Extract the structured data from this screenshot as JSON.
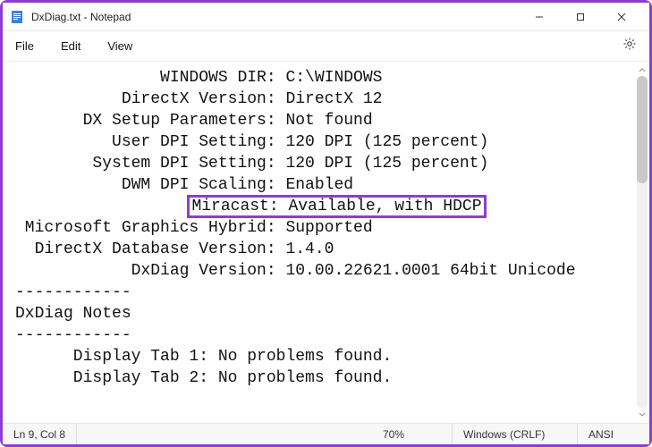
{
  "titlebar": {
    "title": "DxDiag.txt - Notepad"
  },
  "menu": {
    "file": "File",
    "edit": "Edit",
    "view": "View"
  },
  "content": {
    "lines": [
      "               WINDOWS DIR: C:\\WINDOWS",
      "           DirectX Version: DirectX 12",
      "       DX Setup Parameters: Not found",
      "          User DPI Setting: 120 DPI (125 percent)",
      "        System DPI Setting: 120 DPI (125 percent)",
      "           DWM DPI Scaling: Enabled",
      "                  Miracast: Available, with HDCP",
      " Microsoft Graphics Hybrid: Supported",
      "  DirectX Database Version: 1.4.0",
      "            DxDiag Version: 10.00.22621.0001 64bit Unicode",
      "",
      "------------",
      "DxDiag Notes",
      "------------",
      "      Display Tab 1: No problems found.",
      "      Display Tab 2: No problems found."
    ],
    "highlight_line_index": 6
  },
  "status": {
    "position": "Ln 9, Col 8",
    "zoom": "70%",
    "line_ending": "Windows (CRLF)",
    "encoding": "ANSI"
  }
}
